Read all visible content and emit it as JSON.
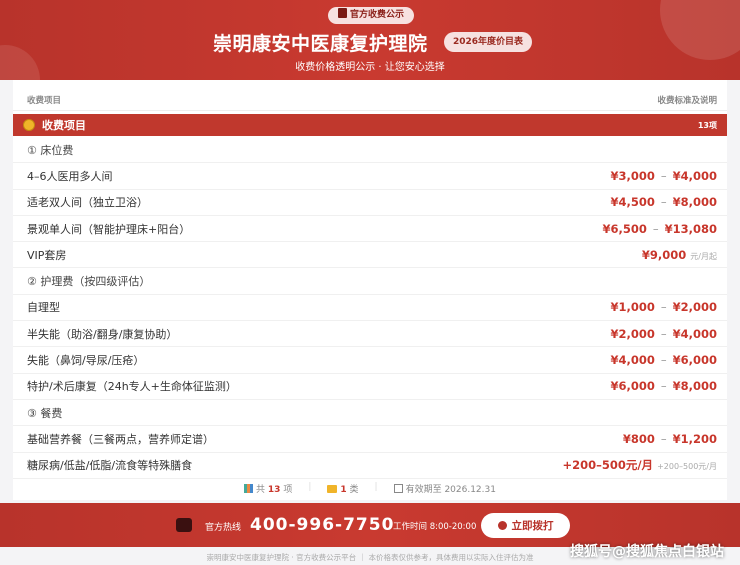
{
  "header": {
    "official_badge": "官方收费公示",
    "title": "崇明康安中医康复护理院",
    "year_badge": "2026年度价目表",
    "subtitle": "收费价格透明公示 · 让您安心选择"
  },
  "table": {
    "col_left": "收费项目",
    "col_right": "收费标准及说明",
    "section_title": "收费项目",
    "section_count": "13项",
    "rows": [
      {
        "type": "cat",
        "label": "① 床位费"
      },
      {
        "type": "item",
        "label": "4–6人医用多人间",
        "low": "¥3,000",
        "high": "¥4,000"
      },
      {
        "type": "item",
        "label": "适老双人间（独立卫浴）",
        "low": "¥4,500",
        "high": "¥8,000"
      },
      {
        "type": "item",
        "label": "景观单人间（智能护理床+阳台）",
        "low": "¥6,500",
        "high": "¥13,080"
      },
      {
        "type": "single",
        "label": "VIP套房",
        "price": "¥9,000",
        "unit": "元/月起"
      },
      {
        "type": "cat",
        "label": "② 护理费（按四级评估）"
      },
      {
        "type": "item",
        "label": "自理型",
        "low": "¥1,000",
        "high": "¥2,000"
      },
      {
        "type": "item",
        "label": "半失能（助浴/翻身/康复协助）",
        "low": "¥2,000",
        "high": "¥4,000"
      },
      {
        "type": "item",
        "label": "失能（鼻饲/导尿/压疮）",
        "low": "¥4,000",
        "high": "¥6,000"
      },
      {
        "type": "item",
        "label": "特护/术后康复（24h专人+生命体征监测）",
        "low": "¥6,000",
        "high": "¥8,000"
      },
      {
        "type": "cat",
        "label": "③ 餐费"
      },
      {
        "type": "item",
        "label": "基础营养餐（三餐两点，营养师定谱）",
        "low": "¥800",
        "high": "¥1,200"
      },
      {
        "type": "extra",
        "label": "糖尿病/低盐/低脂/流食等特殊膳食",
        "price": "+200–500元/月",
        "note": "+200–500元/月"
      }
    ]
  },
  "stats": {
    "total_prefix": "共",
    "total_count": "13",
    "total_suffix": "项",
    "category_count": "1",
    "category_suffix": "类",
    "valid_until": "有效期至 2026.12.31"
  },
  "footer": {
    "hotline_label": "官方热线",
    "hotline_number": "400-996-7750",
    "hours": "工作时间 8:00-20:00",
    "call_button": "立即拨打",
    "disclaimer": "崇明康安中医康复护理院 · 官方收费公示平台 ｜ 本价格表仅供参考，具体费用以实际入住评估为准",
    "watermark": "搜狐号@搜狐焦点白银站"
  },
  "colors": {
    "brand_red": "#c0382d",
    "price_red": "#c8362b"
  }
}
